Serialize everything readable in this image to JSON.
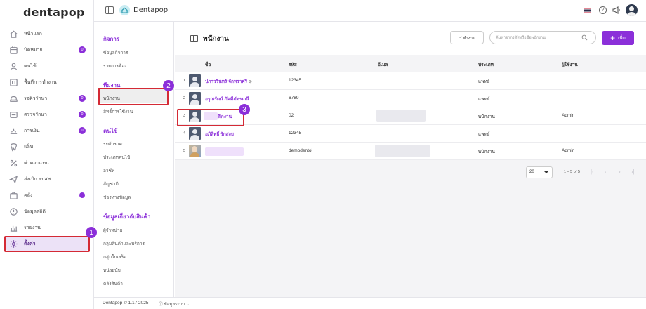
{
  "app": {
    "logo": "dentapop",
    "brand": "Dentapop"
  },
  "nav": {
    "items": [
      {
        "label": "หน้าแรก",
        "icon": "home-icon"
      },
      {
        "label": "นัดหมาย",
        "icon": "calendar-icon",
        "badge": "0"
      },
      {
        "label": "คนไข้",
        "icon": "user-icon"
      },
      {
        "label": "พื้นที่การทำงาน",
        "icon": "workspace-icon"
      },
      {
        "label": "รอคิวรักษา",
        "icon": "queue-icon",
        "badge": "0"
      },
      {
        "label": "ตรวจรักษา",
        "icon": "stethoscope-icon",
        "badge": "0"
      },
      {
        "label": "การเงิน",
        "icon": "money-icon",
        "badge": "0"
      },
      {
        "label": "แล็บ",
        "icon": "tooth-icon"
      },
      {
        "label": "ค่าตอบแทน",
        "icon": "percent-icon"
      },
      {
        "label": "ส่งเบิก สปสช.",
        "icon": "send-icon"
      },
      {
        "label": "คลัง",
        "icon": "store-icon",
        "dot": true
      },
      {
        "label": "ข้อมูลสถิติ",
        "icon": "stats-icon"
      },
      {
        "label": "รายงาน",
        "icon": "report-icon"
      },
      {
        "label": "ตั้งค่า",
        "icon": "gear-icon"
      }
    ]
  },
  "submenu": {
    "sections": [
      {
        "title": "กิจการ",
        "items": [
          "ข้อมูลกิจการ",
          "รายการห้อง"
        ]
      },
      {
        "title": "ทีมงาน",
        "items": [
          "พนักงาน",
          "สิทธิ์การใช้งาน"
        ]
      },
      {
        "title": "คนไข้",
        "items": [
          "ระดับราคา",
          "ประเภทคนไข้",
          "อาชีพ",
          "สัญชาติ",
          "ช่องทางข้อมูล"
        ]
      },
      {
        "title": "ข้อมูลเกี่ยวกับสินค้า",
        "items": [
          "ผู้จำหน่าย",
          "กลุ่มสินค้าและบริการ",
          "กลุ่มใบเสร็จ",
          "หน่วยนับ",
          "คลังสินค้า"
        ]
      }
    ]
  },
  "page": {
    "title": "พนักงาน",
    "status_button": "ทำงาน",
    "search_placeholder": "ค้นหาจากรหัสหรือชื่อพนักงาน",
    "add_button": "เพิ่ม"
  },
  "table": {
    "headers": [
      "ชื่อ",
      "รหัส",
      "อีเมล",
      "ประเภท",
      "ผู้ใช้งาน"
    ],
    "rows": [
      {
        "no": "1",
        "name": "ปภาวรินทร์ จักทราศรี",
        "code": "12345",
        "email": "",
        "type": "แพทย์",
        "user": ""
      },
      {
        "no": "2",
        "name": "อรุณรัตน์ ภัคดีภัทรมณี",
        "code": "6789",
        "email": "",
        "type": "แพทย์",
        "user": ""
      },
      {
        "no": "3",
        "name": "ฝึกงาน",
        "code": "02",
        "email": "",
        "type": "พนักงาน",
        "user": "Admin"
      },
      {
        "no": "4",
        "name": "อภิสิทธิ์ รักสงบ",
        "code": "12345",
        "email": "",
        "type": "แพทย์",
        "user": ""
      },
      {
        "no": "5",
        "name": "",
        "code": "demodentol",
        "email": "",
        "type": "พนักงาน",
        "user": "Admin"
      }
    ]
  },
  "pagination": {
    "page_size": "20",
    "range": "1 – 5 of 5"
  },
  "footer": {
    "version": "Dentapop © 1.17 2025",
    "system": "ข้อมูลระบบ"
  },
  "callouts": [
    "1",
    "2",
    "3"
  ],
  "colors": {
    "accent": "#8b2fd9",
    "highlight": "#d42a35"
  }
}
